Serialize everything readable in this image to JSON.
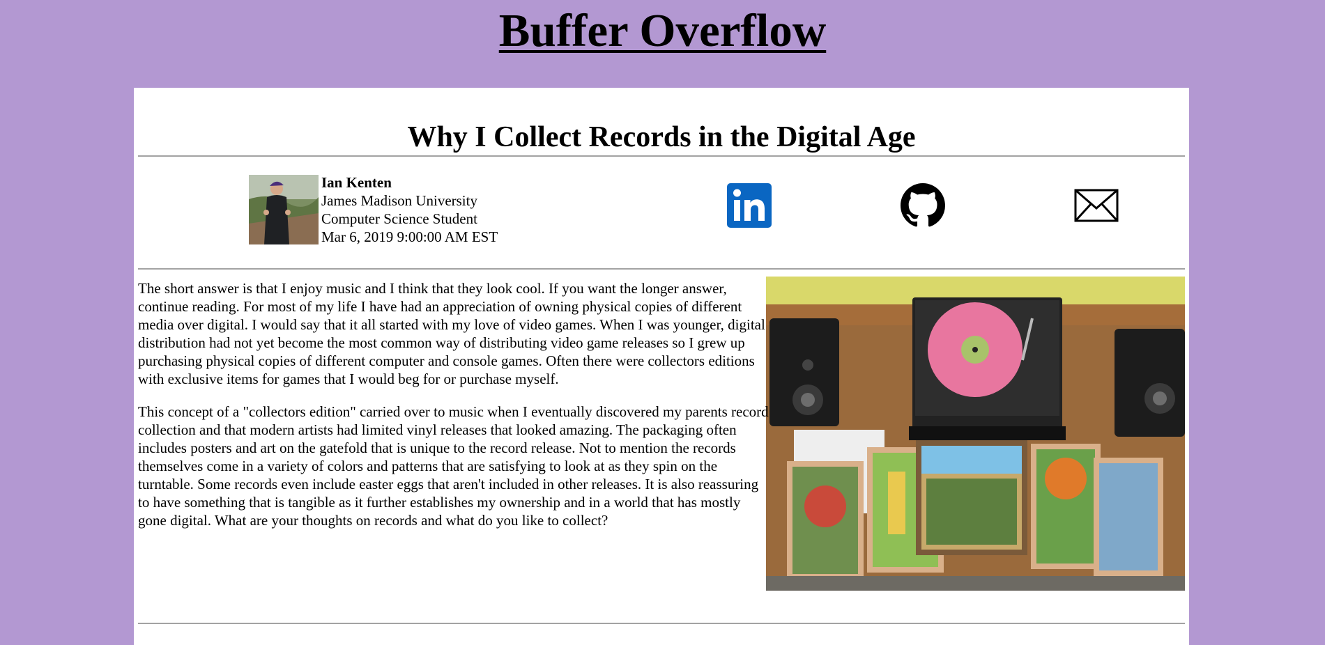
{
  "site": {
    "title": "Buffer Overflow"
  },
  "post": {
    "title": "Why I Collect Records in the Digital Age",
    "author": {
      "name": "Ian Kenten",
      "school": "James Madison University",
      "role": "Computer Science Student",
      "date": "Mar 6, 2019 9:00:00 AM EST"
    },
    "paragraphs": [
      "The short answer is that I enjoy music and I think that they look cool. If you want the longer answer, continue reading. For most of my life I have had an appreciation of owning physical copies of different media over digital. I would say that it all started with my love of video games. When I was younger, digital distribution had not yet become the most common way of distributing video game releases so I grew up purchasing physical copies of different computer and console games. Often there were collectors editions with exclusive items for games that I would beg for or purchase myself.",
      "This concept of a \"collectors edition\" carried over to music when I eventually discovered my parents record collection and that modern artists had limited vinyl releases that looked amazing. The packaging often includes posters and art on the gatefold that is unique to the record release. Not to mention the records themselves come in a variety of colors and patterns that are satisfying to look at as they spin on the turntable. Some records even include easter eggs that aren't included in other releases. It is also reassuring to have something that is tangible as it further establishes my ownership and in a world that has mostly gone digital. What are your thoughts on records and what do you like to collect?"
    ]
  },
  "social": {
    "links": [
      {
        "icon": "linkedin-icon"
      },
      {
        "icon": "github-icon"
      },
      {
        "icon": "email-icon"
      }
    ]
  },
  "colors": {
    "page_bg": "#b398d2",
    "card_bg": "#ffffff",
    "linkedin_blue": "#0a66c2"
  }
}
